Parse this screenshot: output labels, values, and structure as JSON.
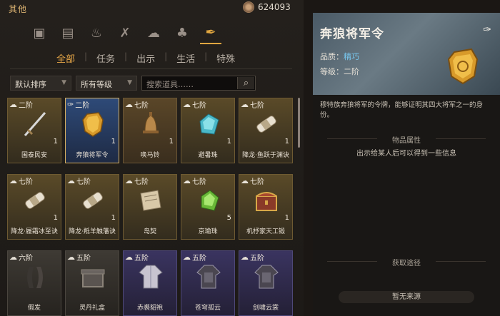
{
  "window": {
    "title": "其他"
  },
  "currency": {
    "amount": "624093"
  },
  "category_tabs": [
    "box-icon",
    "book-icon",
    "flame-icon",
    "crossed-tools-icon",
    "cloud-icon",
    "leaf-icon",
    "scroll-token-icon"
  ],
  "sub_tabs": [
    "全部",
    "任务",
    "出示",
    "生活",
    "特殊"
  ],
  "filters": {
    "sort": "默认排序",
    "grade": "所有等级",
    "search_placeholder": "搜索道具……"
  },
  "items": [
    {
      "grade": "二阶",
      "name": "国泰民安",
      "count": "1",
      "quality": "gold",
      "art": "sword",
      "bound": false
    },
    {
      "grade": "二阶",
      "name": "奔狼将军令",
      "count": "1",
      "quality": "blue",
      "art": "token",
      "bound": true
    },
    {
      "grade": "七阶",
      "name": "唤马铃",
      "count": "1",
      "quality": "orange",
      "art": "bell",
      "bound": false
    },
    {
      "grade": "七阶",
      "name": "避暑珠",
      "count": "1",
      "quality": "gold",
      "art": "gem-blue",
      "bound": false
    },
    {
      "grade": "七阶",
      "name": "降龙·鱼跃于渊诀",
      "count": "1",
      "quality": "gold",
      "art": "scroll",
      "bound": false
    },
    {
      "grade": "七阶",
      "name": "降龙·履霜冰至诀",
      "count": "1",
      "quality": "gold",
      "art": "scroll",
      "bound": false
    },
    {
      "grade": "七阶",
      "name": "降龙·羝羊触藩诀",
      "count": "1",
      "quality": "gold",
      "art": "scroll",
      "bound": false
    },
    {
      "grade": "七阶",
      "name": "岛契",
      "count": "",
      "quality": "gold",
      "art": "paper",
      "bound": false
    },
    {
      "grade": "七阶",
      "name": "京瑜珠",
      "count": "5",
      "quality": "gold",
      "art": "gem-green",
      "bound": false
    },
    {
      "grade": "七阶",
      "name": "机杼家天工锻",
      "count": "1",
      "quality": "gold",
      "art": "chest",
      "bound": false
    },
    {
      "grade": "六阶",
      "name": "假发",
      "count": "",
      "quality": "gray",
      "art": "hair",
      "bound": false
    },
    {
      "grade": "五阶",
      "name": "灵丹礼盒",
      "count": "",
      "quality": "gray",
      "art": "box",
      "bound": false
    },
    {
      "grade": "五阶",
      "name": "赤裘貂袍",
      "count": "",
      "quality": "purple",
      "art": "robe",
      "bound": false
    },
    {
      "grade": "五阶",
      "name": "苍穹孤云",
      "count": "",
      "quality": "purple",
      "art": "armor",
      "bound": false
    },
    {
      "grade": "五阶",
      "name": "剑啸云裳",
      "count": "",
      "quality": "purple",
      "art": "armor",
      "bound": false
    }
  ],
  "detail": {
    "title": "奔狼将军令",
    "quality_label": "品质：",
    "quality_value": "精巧",
    "grade_label": "等级：",
    "grade_value": "二阶",
    "description": "穆特族奔狼将军的令牌，能够证明其四大将军之一的身份。",
    "attr_header": "物品属性",
    "attr_text": "出示给某人后可以得到一些信息",
    "source_header": "获取途径",
    "source_button": "暂无来源"
  },
  "colors": {
    "accent": "#e8a848",
    "quality_blue": "#78c8f0"
  }
}
